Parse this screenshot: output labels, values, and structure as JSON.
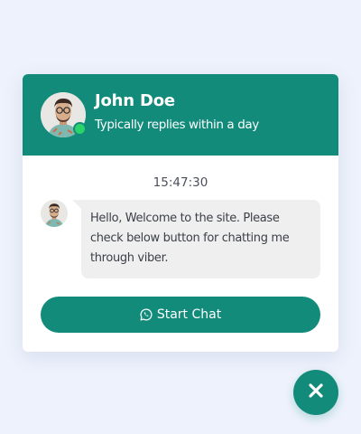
{
  "header": {
    "name": "John Doe",
    "status_text": "Typically replies within a day"
  },
  "chat": {
    "time": "15:47:30",
    "message": "Hello, Welcome to the site. Please check below button for chatting me through viber."
  },
  "action": {
    "label": "Start Chat",
    "icon": "whatsapp-icon"
  },
  "fab": {
    "icon": "close-icon"
  },
  "colors": {
    "brand": "#138b7b",
    "online": "#2bd46a",
    "background": "#eef2fc",
    "bubble": "#efefef"
  }
}
